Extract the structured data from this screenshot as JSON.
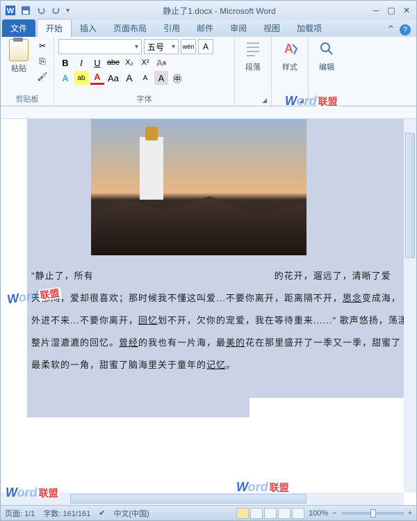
{
  "title": {
    "filename": "静止了1.docx",
    "app": "Microsoft Word",
    "full": "静止了1.docx - Microsoft Word"
  },
  "tabs": {
    "file": "文件",
    "home": "开始",
    "insert": "插入",
    "layout": "页面布局",
    "ref": "引用",
    "mail": "邮件",
    "review": "审阅",
    "view": "视图",
    "addin": "加载项"
  },
  "ribbon": {
    "clipboard": {
      "paste": "粘贴",
      "label": "剪贴板"
    },
    "font": {
      "name": "",
      "size": "五号",
      "wen": "wén",
      "a_box": "A",
      "b": "B",
      "i": "I",
      "u": "U",
      "strike": "abe",
      "x2": "X₂",
      "x2sup": "X²",
      "clear": "Aa",
      "fx": "A",
      "hl": "ab",
      "fc": "A",
      "case": "Aa",
      "grow": "A",
      "shrink": "A",
      "cc": "A",
      "enc": "㊥",
      "label": "字体"
    },
    "para": {
      "btn": "段落",
      "label": ""
    },
    "style": {
      "btn": "样式",
      "label": ""
    },
    "edit": {
      "btn": "编辑",
      "label": ""
    }
  },
  "document": {
    "line1_a": "\"静止了，所有",
    "line1_b": "的花开，遛远了，清晰了爱",
    "line2_a": "天郁闷，爱却很喜欢；那时候我不懂这叫爱...不要你离开，距离隔不开，",
    "line2_u": "思念",
    "line2_b": "变成海，",
    "line3_a": "外进不来...不要你离开，",
    "line3_u": "回忆",
    "line3_b": "划不开，欠你的宠爱，我在等待重来......\" 歌声悠扬，荡漾",
    "line4_a": "整片湿漉漉的回忆。",
    "line4_u1": "曾经",
    "line4_b": "的我也有一片海，最",
    "line4_u2": "美的",
    "line4_c": "花在那里盛开了一季又一季，甜蜜了",
    "line5_a": "最柔软的一角，甜蜜了脑海里关于童年的",
    "line5_u": "记忆",
    "line5_b": "。"
  },
  "status": {
    "page": "页面: 1/1",
    "words": "字数: 161/161",
    "lang": "中文(中国)",
    "zoom": "100%",
    "zoom_minus": "−",
    "zoom_plus": "+"
  },
  "watermark": {
    "w": "W",
    "ord": "ord",
    "lm": "联盟"
  }
}
